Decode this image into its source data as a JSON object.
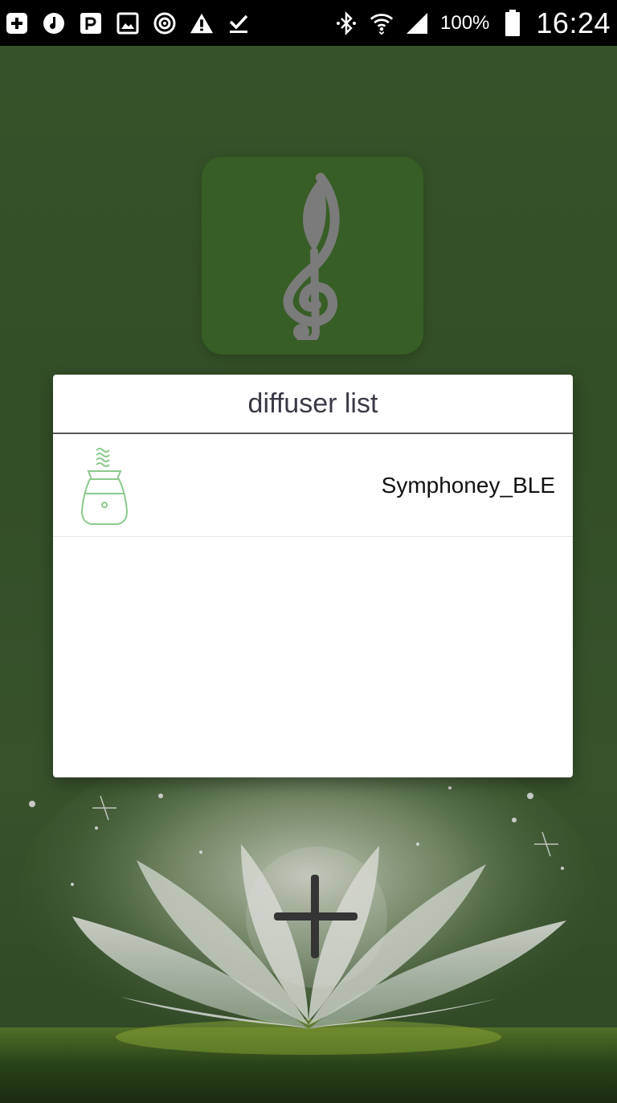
{
  "status_bar": {
    "icons_left": [
      "add-box-icon",
      "music-note-icon",
      "p-app-icon",
      "image-icon",
      "sync-icon",
      "warning-icon",
      "download-done-icon"
    ],
    "icons_right": [
      "bluetooth-icon",
      "wifi-icon",
      "signal-icon",
      "battery-icon"
    ],
    "battery_level": "100%",
    "time": "16:24"
  },
  "app": {
    "logo_icon": "treble-clef-leaf-icon",
    "accent_color": "#3f6b2c"
  },
  "dialog": {
    "title": "diffuser list",
    "devices": [
      {
        "name": "Symphoney_BLE",
        "icon": "diffuser-icon"
      }
    ]
  },
  "add_button": {
    "icon": "plus-icon"
  }
}
